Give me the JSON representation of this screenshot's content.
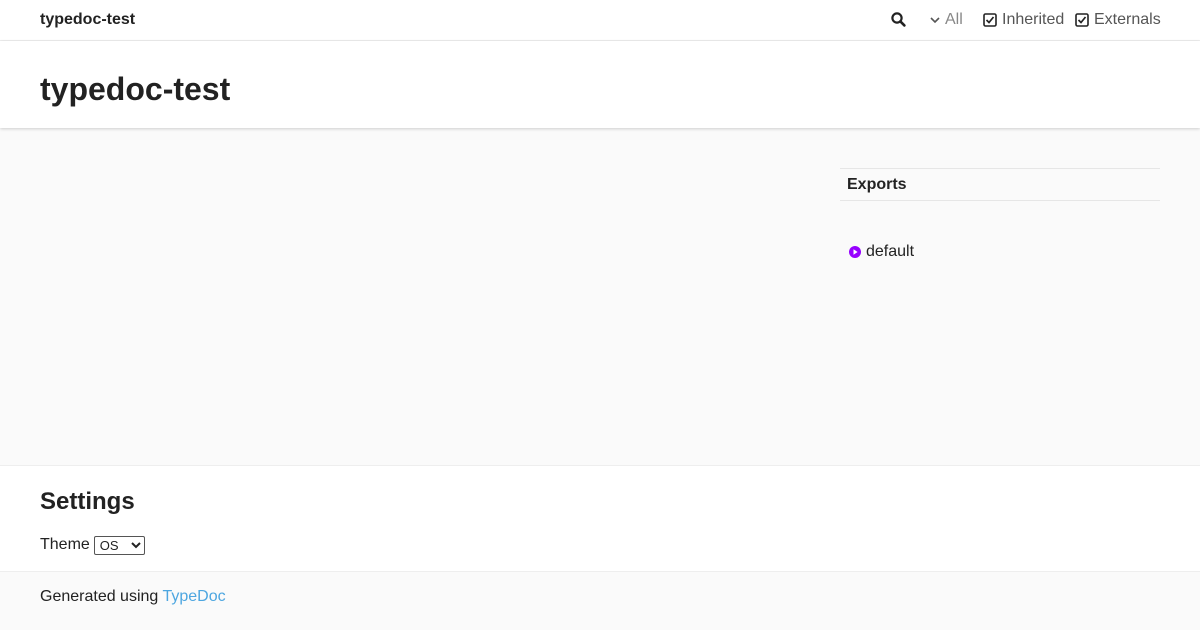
{
  "toolbar": {
    "site_name": "typedoc-test",
    "search_icon": "search-icon",
    "filter_all_label": "All",
    "filter_inherited_label": "Inherited",
    "filter_externals_label": "Externals"
  },
  "header": {
    "title": "typedoc-test"
  },
  "index": {
    "heading": "Exports",
    "items": [
      {
        "label": "default",
        "icon": "function-icon",
        "icon_color": "#9600ff"
      }
    ]
  },
  "settings": {
    "title": "Settings",
    "theme_label": "Theme",
    "theme_selected": "OS"
  },
  "footer": {
    "prefix": "Generated using",
    "link_label": "TypeDoc"
  },
  "colors": {
    "link": "#4da6e0",
    "function_icon": "#9600ff"
  }
}
